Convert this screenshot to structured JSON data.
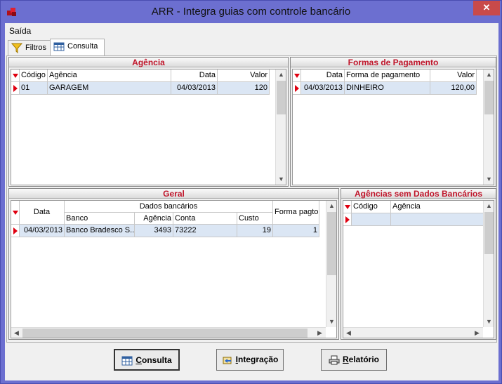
{
  "window": {
    "title": "ARR - Integra guias com controle bancário",
    "close_glyph": "✕",
    "icon": "app-icon"
  },
  "menu": {
    "items": [
      {
        "label": "Saída"
      }
    ]
  },
  "tabs": [
    {
      "label": "Filtros",
      "icon": "funnel-icon"
    },
    {
      "label": "Consulta",
      "icon": "table-icon",
      "active": true
    }
  ],
  "agencia": {
    "title": "Agência",
    "columns": [
      "Código",
      "Agência",
      "Data",
      "Valor"
    ],
    "rows": [
      {
        "codigo": "01",
        "agencia": "GARAGEM",
        "data": "04/03/2013",
        "valor": "120"
      }
    ]
  },
  "formas": {
    "title": "Formas de Pagamento",
    "columns": [
      "Data",
      "Forma de pagamento",
      "Valor"
    ],
    "rows": [
      {
        "data": "04/03/2013",
        "forma": "DINHEIRO",
        "valor": "120,00"
      }
    ]
  },
  "geral": {
    "title": "Geral",
    "group_header": "Dados bancários",
    "columns": {
      "data": "Data",
      "banco": "Banco",
      "agencia": "Agência",
      "conta": "Conta",
      "custo": "Custo",
      "forma": "Forma pagto"
    },
    "rows": [
      {
        "data": "04/03/2013",
        "banco": "Banco Bradesco S...",
        "agencia": "3493",
        "conta": "73222",
        "custo": "19",
        "forma": "1"
      }
    ]
  },
  "sem_dados": {
    "title": "Agências sem Dados Bancários",
    "columns": [
      "Código",
      "Agência"
    ]
  },
  "buttons": {
    "consulta": {
      "prefix": "",
      "underline": "C",
      "rest": "onsulta",
      "icon": "table-icon"
    },
    "integracao": {
      "prefix": "",
      "underline": "I",
      "rest": "ntegração",
      "icon": "integrate-icon"
    },
    "relatorio": {
      "prefix": "",
      "underline": "R",
      "rest": "elatório",
      "icon": "printer-icon"
    }
  },
  "colors": {
    "accent_red": "#c0152a",
    "titlebar": "#6c6fd0",
    "selected_row": "#dbe6f4"
  }
}
